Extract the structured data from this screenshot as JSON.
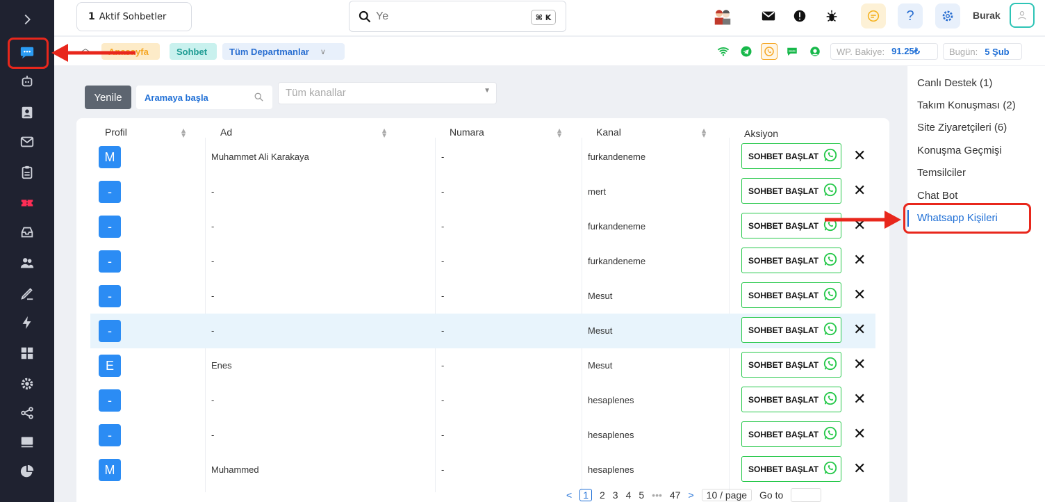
{
  "topbar": {
    "active_count": "1",
    "active_label": "Aktif Sohbetler",
    "search_placeholder": "Ye",
    "shortcut": "⌘ K",
    "user_name": "Burak"
  },
  "breadcrumb": {
    "home": "Anasayfa",
    "chat": "Sohbet",
    "departments": "Tüm Departmanlar"
  },
  "balance": {
    "wp_label": "WP. Bakiye:",
    "wp_value": "91.25₺",
    "today_label": "Bugün:",
    "today_value": "5 Şub"
  },
  "filters": {
    "refresh": "Yenile",
    "search_placeholder": "Aramaya başla",
    "channels_placeholder": "Tüm kanallar"
  },
  "table": {
    "headers": [
      "Profil",
      "Ad",
      "Numara",
      "Kanal",
      "Aksiyon"
    ],
    "action_label": "SOHBET BAŞLAT",
    "rows": [
      {
        "initial": "M",
        "name": "Muhammet Ali Karakaya",
        "number": "-",
        "channel": "furkandeneme"
      },
      {
        "initial": "-",
        "name": "-",
        "number": "-",
        "channel": "mert"
      },
      {
        "initial": "-",
        "name": "-",
        "number": "-",
        "channel": "furkandeneme"
      },
      {
        "initial": "-",
        "name": "-",
        "number": "-",
        "channel": "furkandeneme"
      },
      {
        "initial": "-",
        "name": "-",
        "number": "-",
        "channel": "Mesut"
      },
      {
        "initial": "-",
        "name": "-",
        "number": "-",
        "channel": "Mesut"
      },
      {
        "initial": "E",
        "name": "Enes",
        "number": "-",
        "channel": "Mesut"
      },
      {
        "initial": "-",
        "name": "-",
        "number": "-",
        "channel": "hesaplenes"
      },
      {
        "initial": "-",
        "name": "-",
        "number": "-",
        "channel": "hesaplenes"
      },
      {
        "initial": "M",
        "name": "Muhammed",
        "number": "-",
        "channel": "hesaplenes"
      }
    ]
  },
  "pagination": {
    "prev": "<",
    "pages": [
      "1",
      "2",
      "3",
      "4",
      "5"
    ],
    "dots": "•••",
    "last": "47",
    "next": ">",
    "page_size": "10 / page",
    "goto": "Go to"
  },
  "right_menu": {
    "items": [
      "Canlı Destek (1)",
      "Takım Konuşması (2)",
      "Site Ziyaretçileri (6)",
      "Konuşma Geçmişi",
      "Temsilciler",
      "Chat Bot",
      "Whatsapp Kişileri"
    ]
  },
  "colors": {
    "accent": "#1f6fd6",
    "sidebar": "#1f2230",
    "annotation": "#e8271c",
    "whatsapp": "#26c84a"
  }
}
